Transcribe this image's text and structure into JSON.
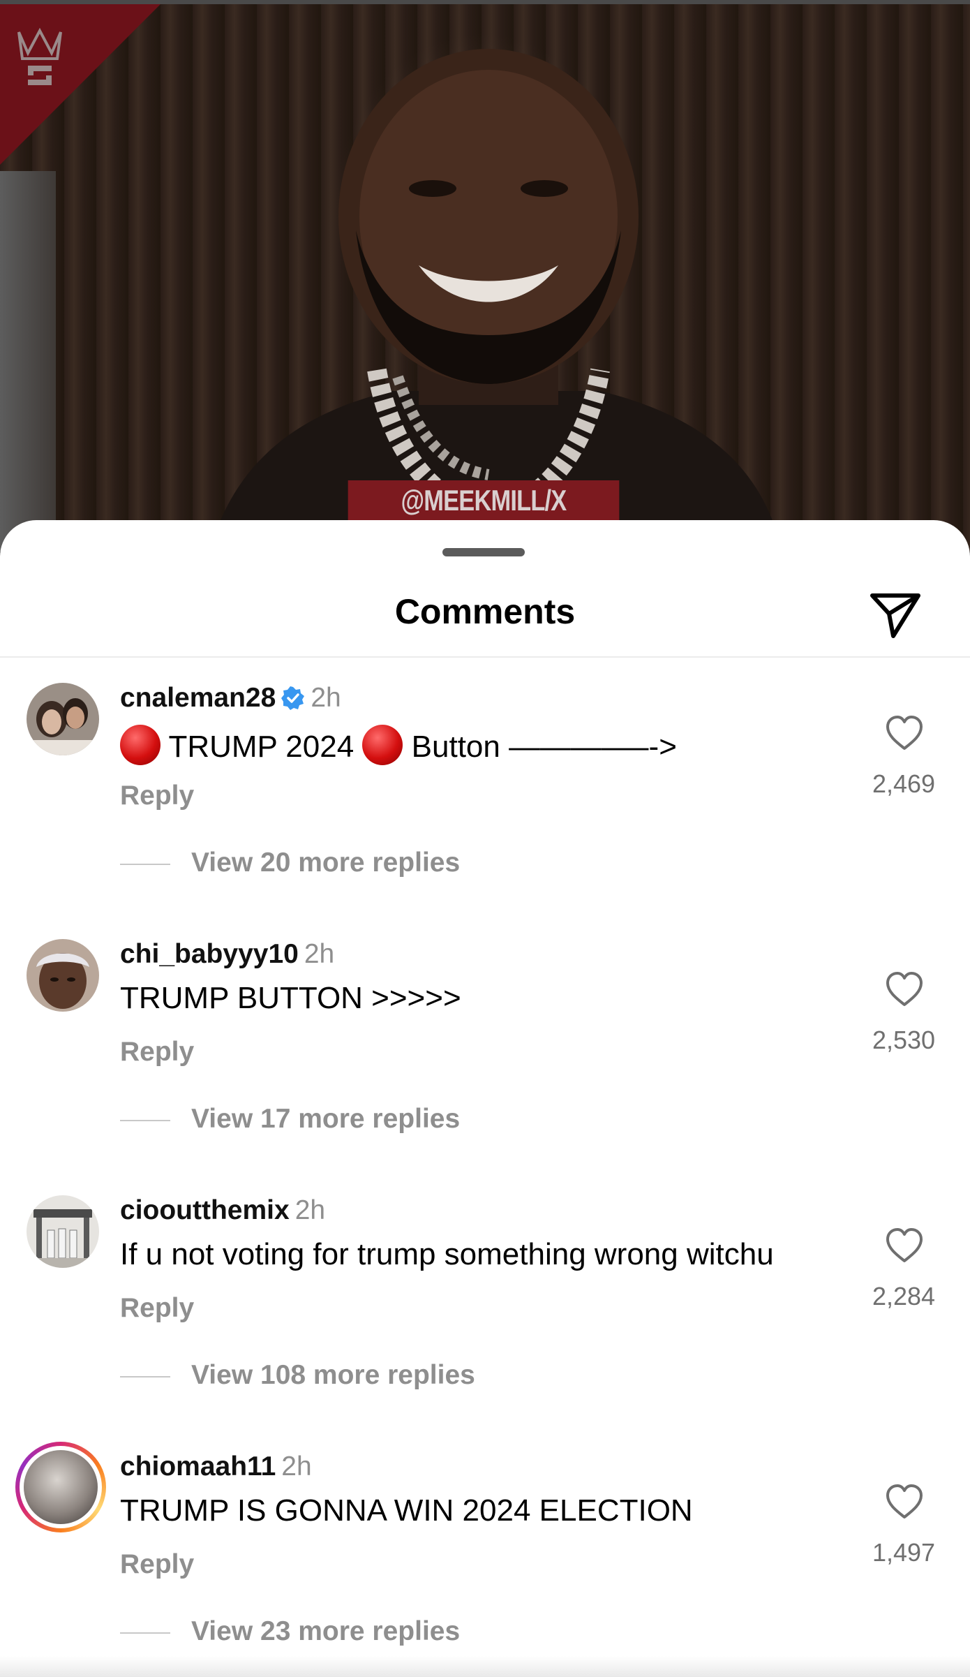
{
  "video": {
    "watermark": "@MEEKMILL/X",
    "brand_icon": "worldstar-crown-icon"
  },
  "sheet": {
    "title": "Comments",
    "share_icon": "paper-plane-share-icon"
  },
  "comments": [
    {
      "username": "cnaleman28",
      "verified": true,
      "time": "2h",
      "text_parts": [
        "TRUMP 2024",
        "Button ———–—->"
      ],
      "reply_label": "Reply",
      "view_replies": "View 20 more replies",
      "likes": "2,469"
    },
    {
      "username": "chi_babyyy10",
      "verified": false,
      "time": "2h",
      "text": "TRUMP BUTTON >>>>>",
      "reply_label": "Reply",
      "view_replies": "View 17 more replies",
      "likes": "2,530"
    },
    {
      "username": "ciooutthemix",
      "verified": false,
      "time": "2h",
      "text": "If u not voting for trump something wrong witchu",
      "reply_label": "Reply",
      "view_replies": "View 108 more replies",
      "likes": "2,284"
    },
    {
      "username": "chiomaah11",
      "verified": false,
      "time": "2h",
      "text": "TRUMP IS GONNA WIN 2024 ELECTION",
      "reply_label": "Reply",
      "view_replies": "View 23 more replies",
      "likes": "1,497",
      "story_ring": true
    }
  ],
  "colors": {
    "sheet_bg": "#ffffff",
    "secondary_text": "#8e8e8e",
    "verified_blue": "#3897f0",
    "watermark_bg": "#7c1a1f"
  }
}
